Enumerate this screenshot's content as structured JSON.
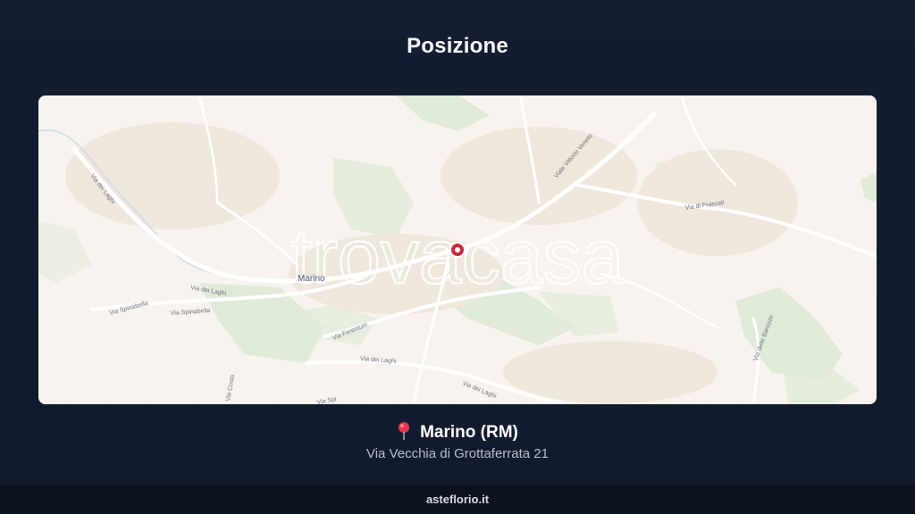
{
  "page": {
    "title": "Posizione"
  },
  "map": {
    "watermark": "trovacasa",
    "town_label": "Marino",
    "road_labels": {
      "via_dei_laghi_nw": "Via dei Laghi",
      "via_dei_laghi_w": "Via dei Laghi",
      "via_spinabella_1": "Via Spinabella",
      "via_spinabella_2": "Via Spinabella",
      "viale_vittorio_veneto": "Viale Vittorio Veneto",
      "via_di_frascati": "Via di Frascati",
      "via_ferentum": "Via Ferentum",
      "via_dei_laghi_s": "Via dei Laghi",
      "via_dei_laghi_se": "Via dei Laghi",
      "via_della_barozze": "Via delle Barozze",
      "via_sud": "Via Costa",
      "via_spi": "Via Spi"
    }
  },
  "location": {
    "icon": "pin-icon",
    "name": "Marino (RM)",
    "address": "Via Vecchia di Grottaferrata 21"
  },
  "footer": {
    "brand": "asteflorio.it"
  },
  "colors": {
    "background": "#121b2f",
    "map_land": "#f8f3ee",
    "map_green": "#dce9d6",
    "marker": "#c8283a",
    "footer_bg": "#0b111d"
  }
}
